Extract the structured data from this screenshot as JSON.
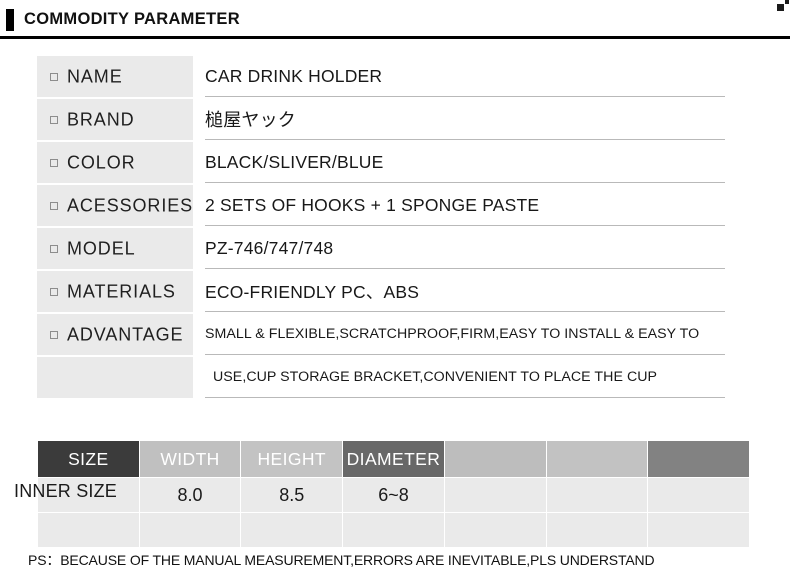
{
  "header": {
    "title": "COMMODITY PARAMETER",
    "accent_color": "#000000",
    "rule_color": "#000000"
  },
  "parameters": [
    {
      "label": "NAME",
      "value": "CAR DRINK HOLDER",
      "style": "normal"
    },
    {
      "label": "BRAND",
      "value": "槌屋ヤック",
      "style": "jp"
    },
    {
      "label": "COLOR",
      "value": "BLACK/SLIVER/BLUE",
      "style": "normal"
    },
    {
      "label": "ACESSORIES",
      "value": "2 SETS OF HOOKS + 1 SPONGE PASTE",
      "style": "normal"
    },
    {
      "label": "MODEL",
      "value": "PZ-746/747/748",
      "style": "normal"
    },
    {
      "label": "MATERIALS",
      "value": "ECO-FRIENDLY PC、ABS",
      "style": "normal"
    },
    {
      "label": "ADVANTAGE",
      "value": "SMALL & FLEXIBLE,SCRATCHPROOF,FIRM,EASY TO INSTALL & EASY TO",
      "style": "small"
    },
    {
      "label": "",
      "value": "USE,CUP STORAGE BRACKET,CONVENIENT TO PLACE THE CUP",
      "style": "small-indent"
    }
  ],
  "size_table": {
    "row_label": "INNER SIZE",
    "headers": [
      {
        "text": "SIZE",
        "bg": "#3b3b3b"
      },
      {
        "text": "WIDTH",
        "bg": "#c0c0c0"
      },
      {
        "text": "HEIGHT",
        "bg": "#c3c3c3"
      },
      {
        "text": "DIAMETER",
        "bg": "#686868"
      },
      {
        "text": "",
        "bg": "#bdbdbd"
      },
      {
        "text": "",
        "bg": "#c2c2c2"
      },
      {
        "text": "",
        "bg": "#828282"
      }
    ],
    "rows": [
      {
        "cells": [
          "",
          "8.0",
          "8.5",
          "6~8",
          "",
          "",
          ""
        ]
      },
      {
        "cells": [
          "",
          "",
          "",
          "",
          "",
          "",
          ""
        ]
      }
    ],
    "cell_bg": "#eaeaea"
  },
  "footer": {
    "note": "PS：BECAUSE OF THE MANUAL MEASUREMENT,ERRORS ARE INEVITABLE,PLS UNDERSTAND"
  }
}
